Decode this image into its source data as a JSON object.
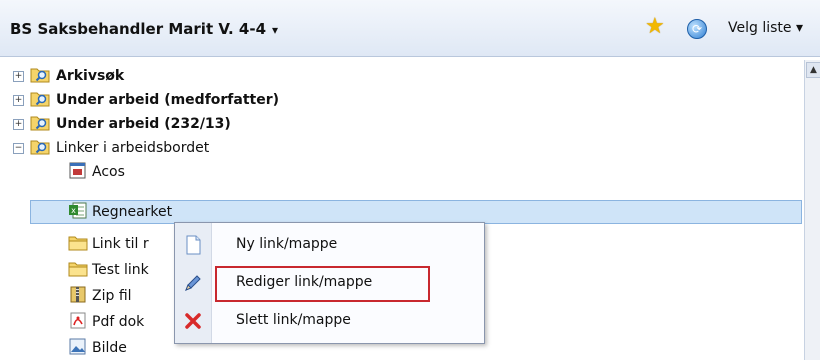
{
  "header": {
    "title": "BS Saksbehandler Marit V. 4-4",
    "velg_liste": "Velg liste"
  },
  "tree": {
    "items": [
      {
        "label": "Arkivsøk",
        "bold": true,
        "type": "search-folder",
        "expander": "+"
      },
      {
        "label": "Under arbeid (medforfatter)",
        "bold": true,
        "type": "search-folder",
        "expander": "+"
      },
      {
        "label": "Under arbeid (232/13)",
        "bold": true,
        "type": "search-folder",
        "expander": "+"
      },
      {
        "label": "Linker i arbeidsbordet",
        "bold": false,
        "type": "search-folder",
        "expander": "−"
      },
      {
        "label": "Acos",
        "type": "app"
      },
      {
        "label": "Regnearket",
        "type": "excel",
        "selected": true
      },
      {
        "label": "Link til r",
        "type": "folder"
      },
      {
        "label": "Test link",
        "type": "folder"
      },
      {
        "label": "Zip fil",
        "type": "zip"
      },
      {
        "label": "Pdf dok",
        "type": "pdf"
      },
      {
        "label": "Bilde",
        "type": "image"
      }
    ]
  },
  "context_menu": {
    "items": [
      {
        "label": "Ny link/mappe",
        "icon": "new-document-icon"
      },
      {
        "label": "Rediger link/mappe",
        "icon": "pencil-icon",
        "highlighted": true
      },
      {
        "label": "Slett link/mappe",
        "icon": "delete-x-icon"
      }
    ]
  },
  "colors": {
    "selection": "#cfe4f8",
    "highlight_border": "#c8282f",
    "star": "#f2b800"
  }
}
